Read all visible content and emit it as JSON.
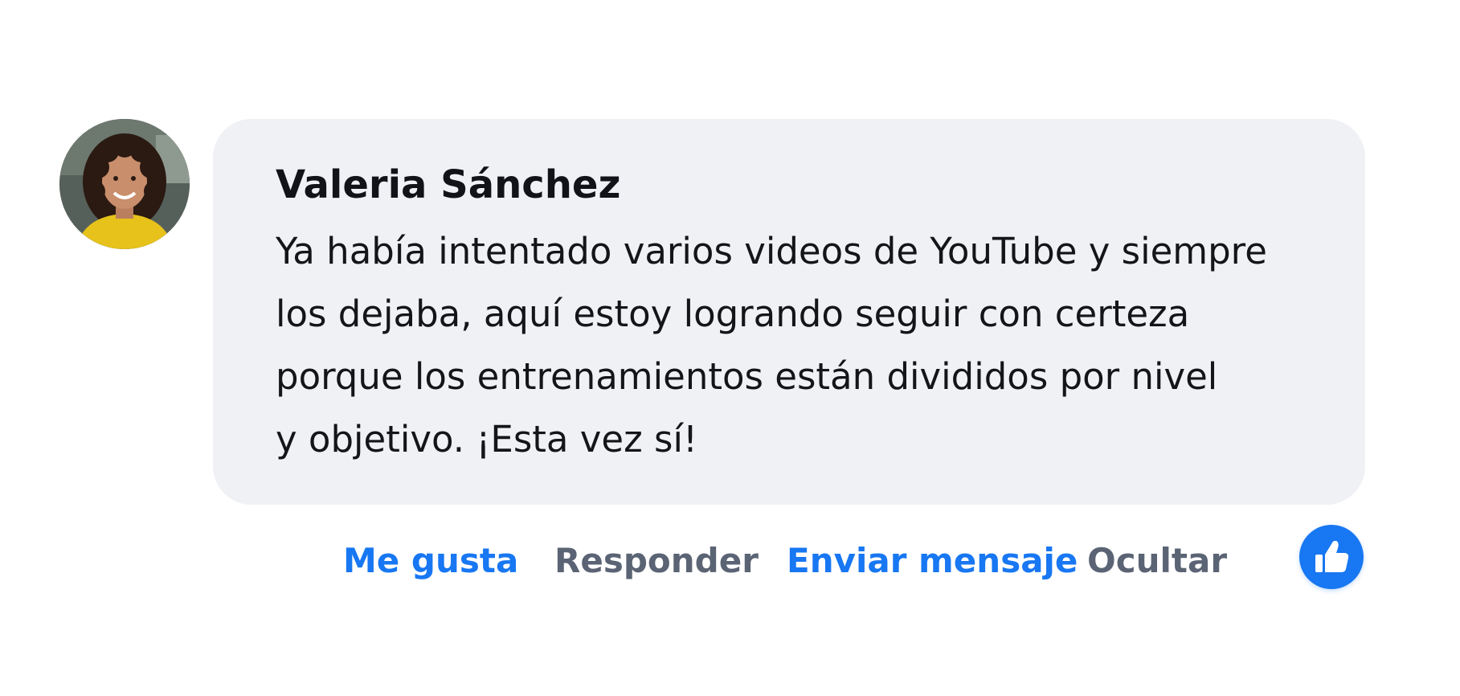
{
  "comment": {
    "author": "Valeria Sánchez",
    "text_lines": [
      "Ya había intentado varios videos de YouTube y siempre",
      "los dejaba, aquí estoy logrando seguir con certeza",
      "porque los entrenamientos están divididos por nivel",
      "y objetivo. ¡Esta vez sí!"
    ]
  },
  "actions": {
    "like": "Me gusta",
    "reply": "Responder",
    "send_message": "Enviar mensaje",
    "hide": "Ocultar"
  },
  "reaction": {
    "icon": "thumbs-up-icon"
  },
  "colors": {
    "bubble": "#f0f1f5",
    "accent_blue": "#1877f2",
    "muted_grey": "#5b6474",
    "text": "#141518"
  }
}
